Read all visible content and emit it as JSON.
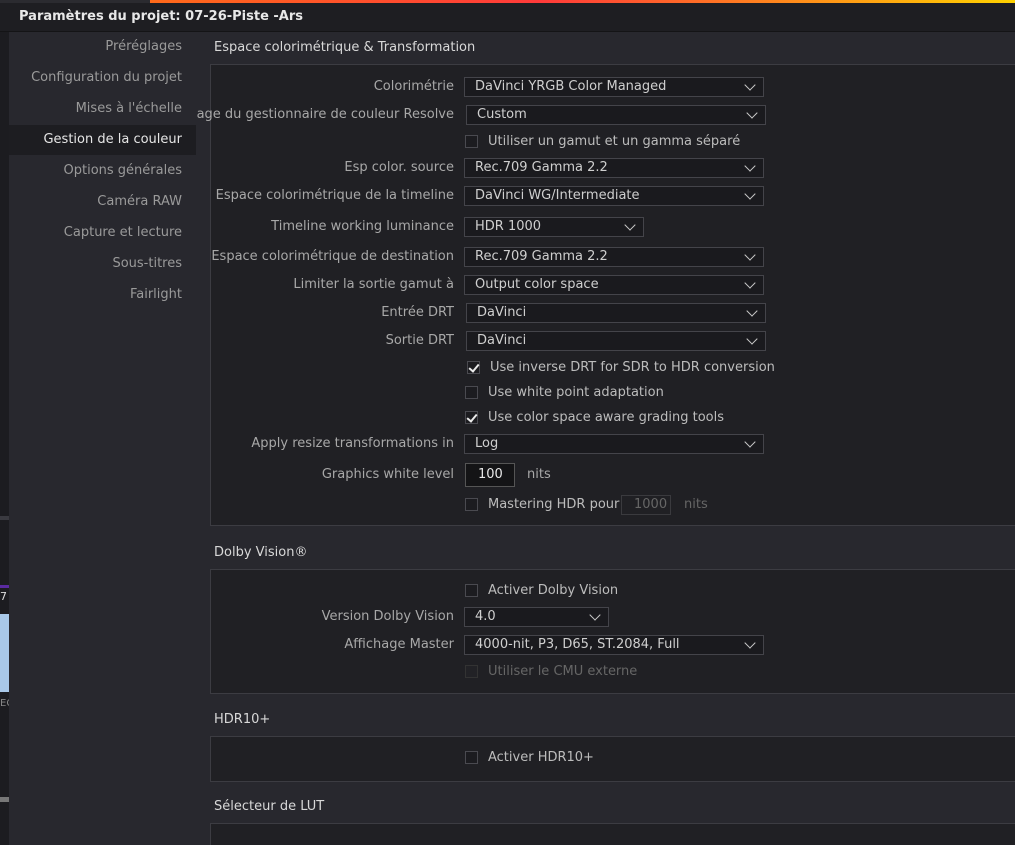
{
  "window": {
    "title_prefix": "Paramètres du projet:",
    "project_name": "07-26-Piste -Ars"
  },
  "sidebar": {
    "items": [
      {
        "label": "Préréglages"
      },
      {
        "label": "Configuration du projet"
      },
      {
        "label": "Mises à l'échelle"
      },
      {
        "label": "Gestion de la couleur",
        "active": true
      },
      {
        "label": "Options générales"
      },
      {
        "label": "Caméra RAW"
      },
      {
        "label": "Capture et lecture"
      },
      {
        "label": "Sous-titres"
      },
      {
        "label": "Fairlight"
      }
    ]
  },
  "left_edge": {
    "fragment_1": "7",
    "fragment_2": "EC"
  },
  "color_section": {
    "title": "Espace colorimétrique & Transformation",
    "colorimetrie": {
      "label": "Colorimétrie",
      "value": "DaVinci YRGB Color Managed"
    },
    "gestionnaire": {
      "label": "age du gestionnaire de couleur Resolve",
      "value": "Custom"
    },
    "separate_gamut": {
      "label": "Utiliser un gamut et un gamma séparé",
      "checked": false
    },
    "source": {
      "label": "Esp color. source",
      "value": "Rec.709 Gamma 2.2"
    },
    "timeline_space": {
      "label": "Espace colorimétrique de la timeline",
      "value": "DaVinci WG/Intermediate"
    },
    "working_luminance": {
      "label": "Timeline working luminance",
      "value": "HDR 1000"
    },
    "destination": {
      "label": "Espace colorimétrique de destination",
      "value": "Rec.709 Gamma 2.2"
    },
    "limit_gamut": {
      "label": "Limiter la sortie gamut à",
      "value": "Output color space"
    },
    "entree_drt": {
      "label": "Entrée DRT",
      "value": "DaVinci"
    },
    "sortie_drt": {
      "label": "Sortie DRT",
      "value": "DaVinci"
    },
    "inverse_drt": {
      "label": "Use inverse DRT for SDR to HDR conversion",
      "checked": true
    },
    "white_point": {
      "label": "Use white point adaptation",
      "checked": false
    },
    "aware_tools": {
      "label": "Use color space aware grading tools",
      "checked": true
    },
    "resize": {
      "label": "Apply resize transformations in",
      "value": "Log"
    },
    "graphics_white": {
      "label": "Graphics white level",
      "value": "100",
      "unit": "nits"
    },
    "mastering_hdr": {
      "label": "Mastering HDR pour",
      "checked": false,
      "value": "1000",
      "unit": "nits"
    }
  },
  "dolby_section": {
    "title": "Dolby Vision®",
    "enable": {
      "label": "Activer Dolby Vision",
      "checked": false
    },
    "version": {
      "label": "Version Dolby Vision",
      "value": "4.0"
    },
    "master_display": {
      "label": "Affichage Master",
      "value": "4000-nit, P3, D65, ST.2084, Full"
    },
    "external_cmu": {
      "label": "Utiliser le CMU externe",
      "checked": false
    }
  },
  "hdr10_section": {
    "title": "HDR10+",
    "enable": {
      "label": "Activer HDR10+",
      "checked": false
    }
  },
  "lut_section": {
    "title": "Sélecteur de LUT"
  }
}
